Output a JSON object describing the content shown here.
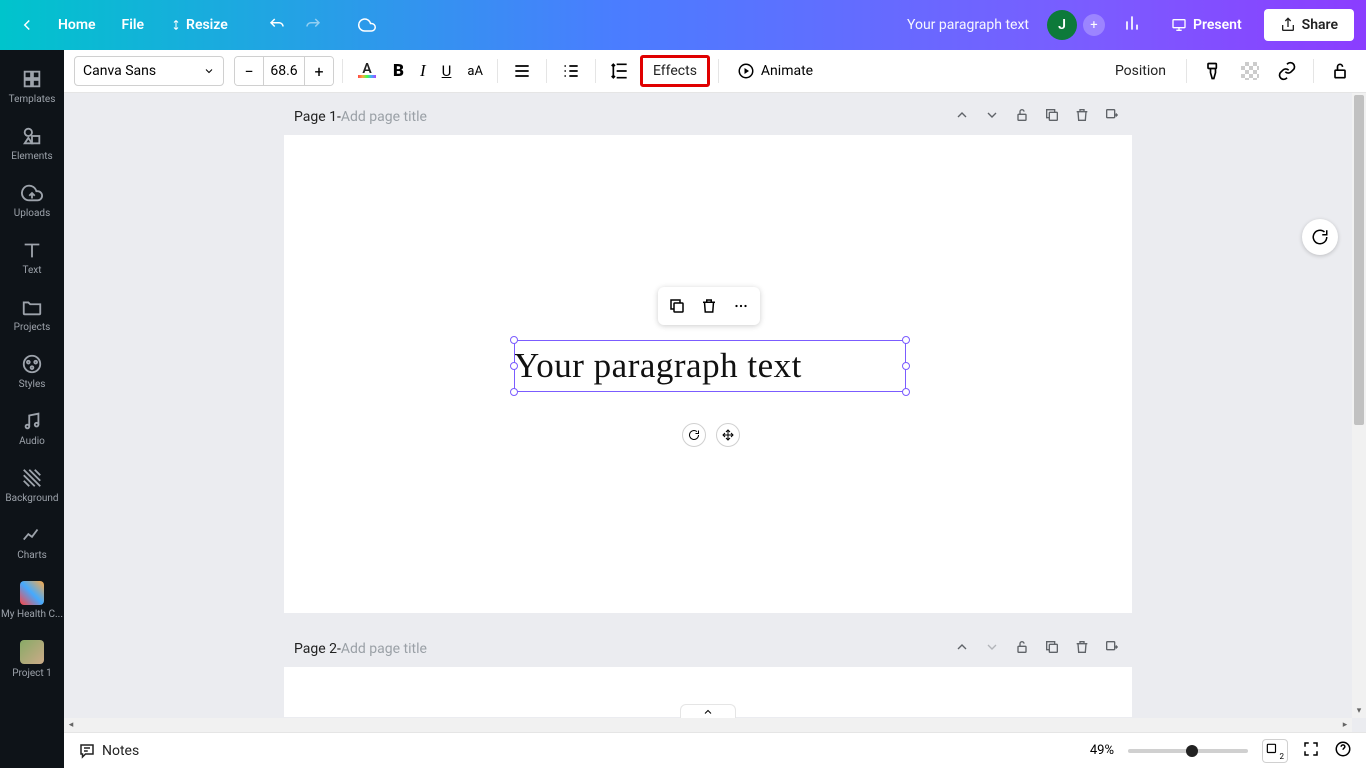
{
  "header": {
    "home": "Home",
    "file": "File",
    "resize": "Resize",
    "doc_title": "Your paragraph text",
    "avatar_initial": "J",
    "present": "Present",
    "share": "Share"
  },
  "sidebar": {
    "items": [
      {
        "label": "Templates"
      },
      {
        "label": "Elements"
      },
      {
        "label": "Uploads"
      },
      {
        "label": "Text"
      },
      {
        "label": "Projects"
      },
      {
        "label": "Styles"
      },
      {
        "label": "Audio"
      },
      {
        "label": "Background"
      },
      {
        "label": "Charts"
      },
      {
        "label": "My Health C..."
      },
      {
        "label": "Project 1"
      }
    ]
  },
  "toolbar": {
    "font_family": "Canva Sans",
    "font_size": "68.6",
    "effects": "Effects",
    "animate": "Animate",
    "position": "Position"
  },
  "pages": {
    "p1_label": "Page 1",
    "p2_label": "Page 2",
    "sep": " - ",
    "placeholder": "Add page title"
  },
  "canvas": {
    "text_content": "Your paragraph text"
  },
  "footer": {
    "notes": "Notes",
    "zoom": "49%",
    "page_count": "2"
  }
}
